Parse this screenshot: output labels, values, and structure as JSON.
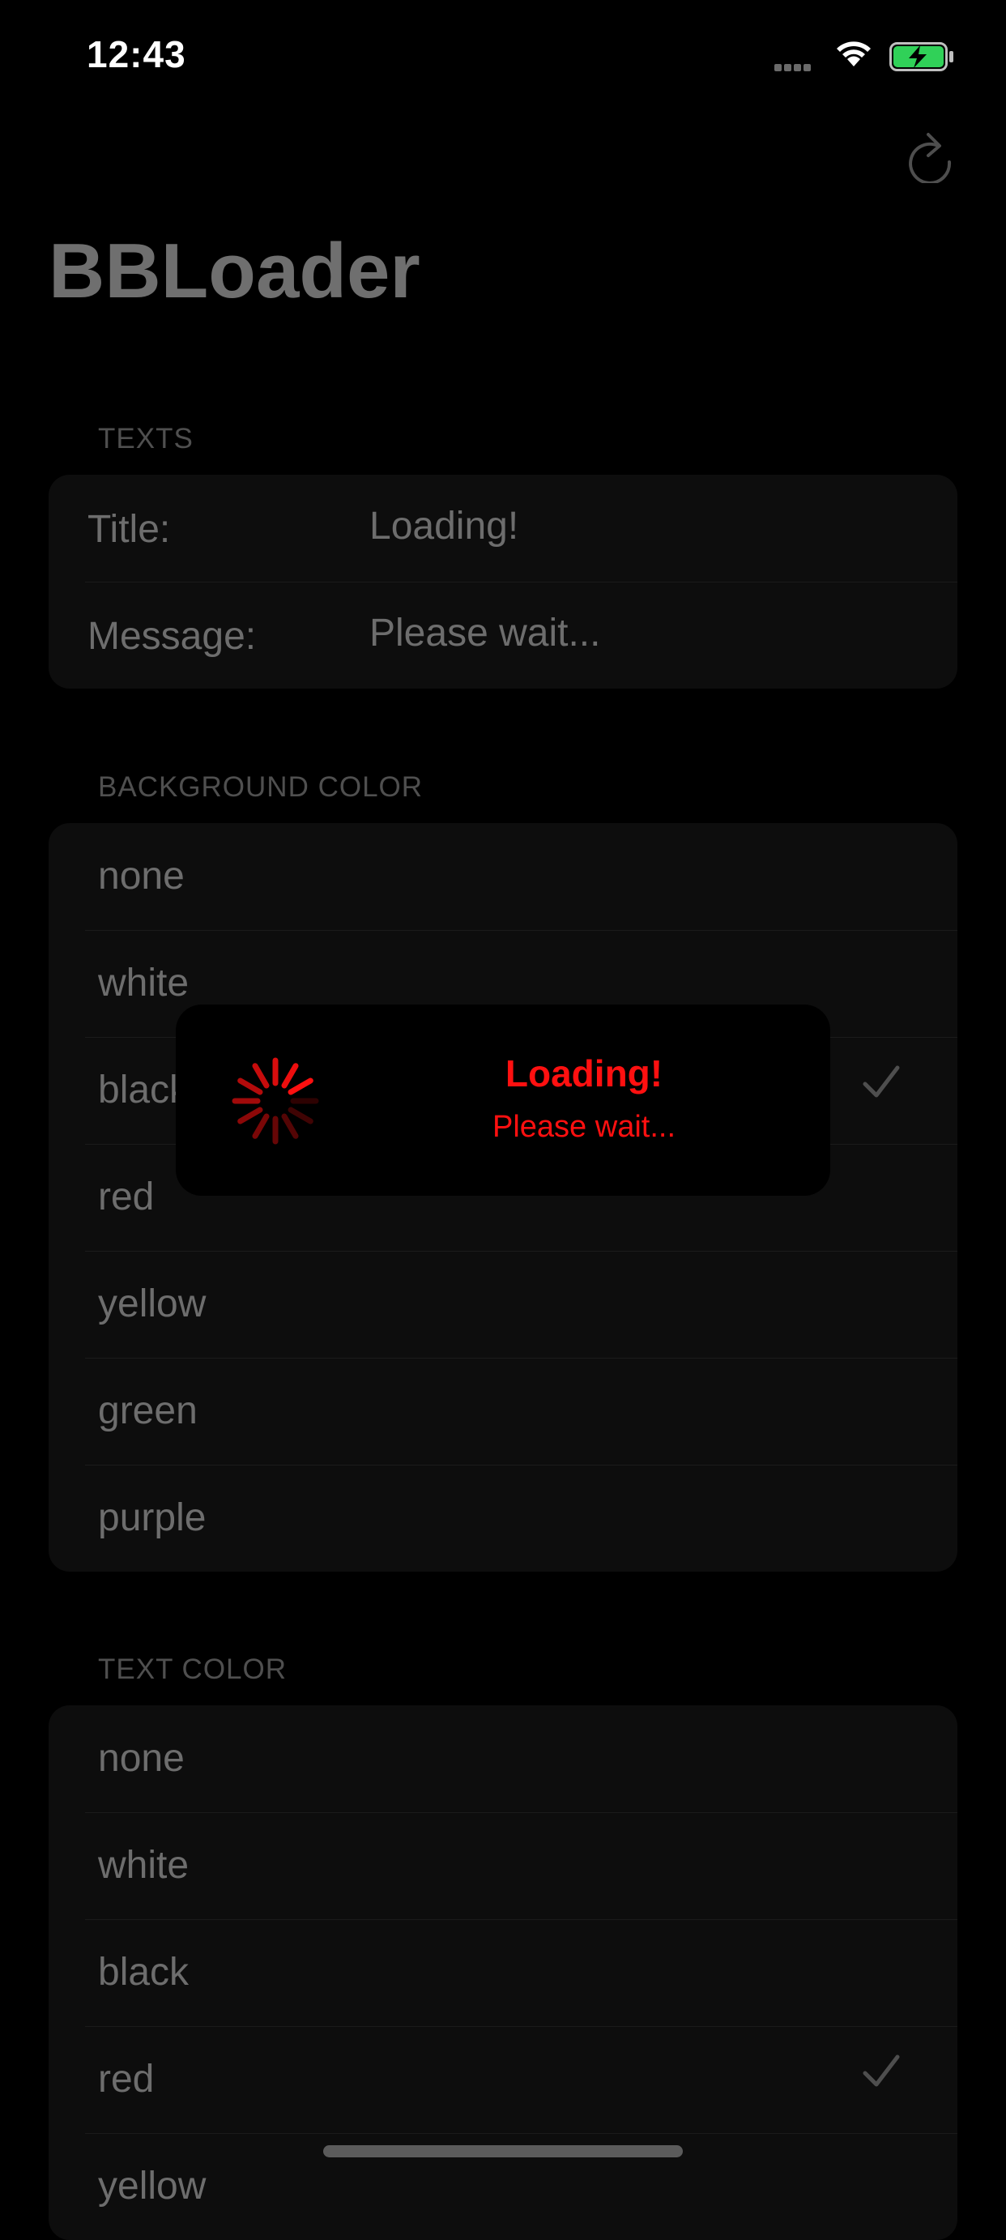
{
  "status": {
    "time": "12:43"
  },
  "nav": {
    "title": "BBLoader"
  },
  "texts": {
    "header": "TEXTS",
    "title_label": "Title:",
    "title_value": "Loading!",
    "message_label": "Message:",
    "message_value": "Please wait..."
  },
  "background_color": {
    "header": "BACKGROUND COLOR",
    "options": [
      "none",
      "white",
      "black",
      "red",
      "yellow",
      "green",
      "purple"
    ],
    "selected": "black"
  },
  "text_color": {
    "header": "TEXT COLOR",
    "options": [
      "none",
      "white",
      "black",
      "red",
      "yellow"
    ],
    "selected": "red"
  },
  "loader": {
    "title": "Loading!",
    "message": "Please wait...",
    "text_color": "#ff1010",
    "background": "#000000"
  },
  "icons": {
    "status_bar": [
      "signal-icon",
      "wifi-icon",
      "battery-charging-icon"
    ],
    "nav": "refresh-icon",
    "selection": "checkmark-icon",
    "loader": "spinner-icon"
  }
}
